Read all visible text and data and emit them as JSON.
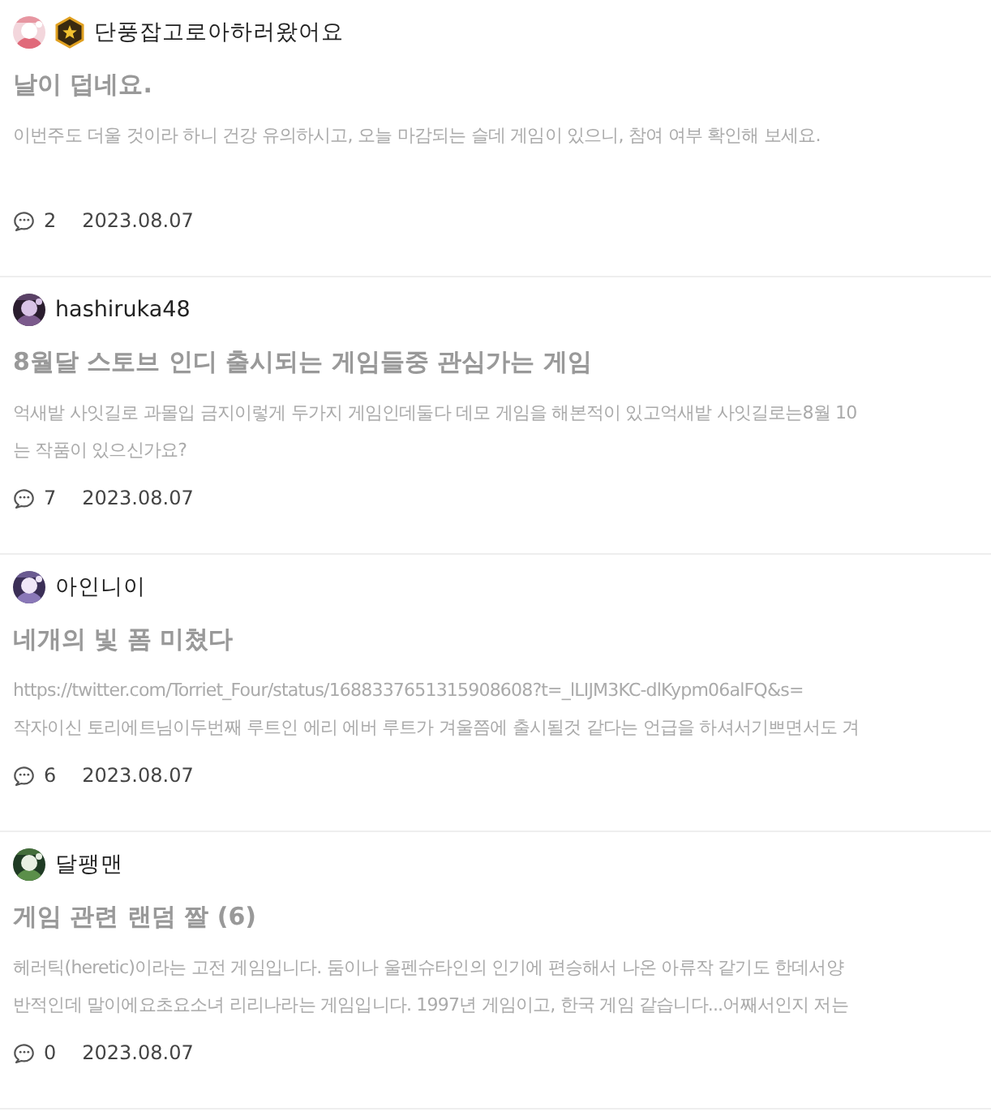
{
  "posts": [
    {
      "author": "단풍잡고로아하러왔어요",
      "badge": true,
      "title": "날이 덥네요.",
      "excerpt": [
        "이번주도 더울 것이라 하니 건강 유의하시고, 오늘 마감되는 슬데 게임이 있으니, 참여 여부 확인해 보세요."
      ],
      "comments": "2",
      "date": "2023.08.07"
    },
    {
      "author": "hashiruka48",
      "badge": false,
      "title": "8월달 스토브 인디 출시되는 게임들중 관심가는 게임",
      "excerpt": [
        "억새밭 사잇길로 과몰입 금지이렇게 두가지 게임인데둘다 데모 게임을 해본적이 있고억새밭 사잇길로는8월 10",
        "는 작품이 있으신가요?"
      ],
      "comments": "7",
      "date": "2023.08.07"
    },
    {
      "author": "아인니이",
      "badge": false,
      "title": "네개의 빛 폼 미쳤다",
      "excerpt": [
        "https://twitter.com/Torriet_Four/status/1688337651315908608?t=_lLIJM3KC-dlKypm06alFQ&s=",
        "작자이신 토리에트님이두번째 루트인 에리 에버 루트가 겨울쯤에 출시될것 같다는 언급을 하셔서기쁘면서도 겨"
      ],
      "comments": "6",
      "date": "2023.08.07"
    },
    {
      "author": "달팽맨",
      "badge": false,
      "title": "게임 관련 랜덤 짤 (6)",
      "excerpt": [
        "헤러틱(heretic)이라는 고전 게임입니다. 둠이나 울펜슈타인의 인기에 편승해서 나온 아류작 같기도 한데서양",
        "반적인데 말이에요초요소녀 리리나라는 게임입니다. 1997년 게임이고, 한국 게임 같습니다...어째서인지 저는"
      ],
      "comments": "0",
      "date": "2023.08.07"
    }
  ]
}
